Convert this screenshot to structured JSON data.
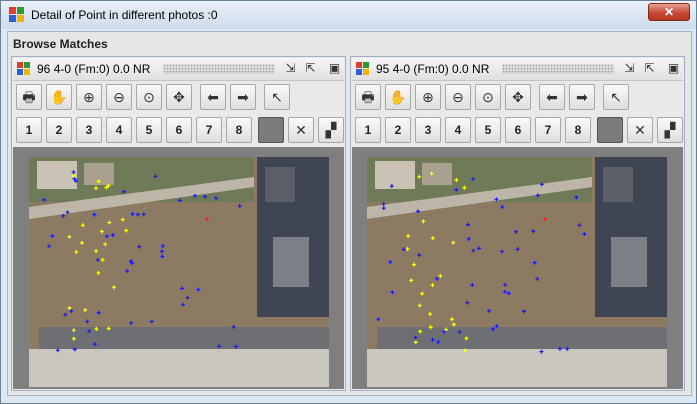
{
  "window": {
    "title": "Detail of Point in different photos :0",
    "close_symbol": "✕",
    "icon": "app-grid-icon"
  },
  "frame": {
    "label": "Browse Matches"
  },
  "panels": [
    {
      "photo_id": "96",
      "photo_label": "4-0 (Fm:0) 0.0  NR",
      "header_icon": "photo-grid-icon"
    },
    {
      "photo_id": "95",
      "photo_label": "4-0 (Fm:0) 0.0  NR",
      "header_icon": "photo-grid-icon"
    }
  ],
  "toolbar": {
    "tools": [
      {
        "name": "print-icon",
        "glyph": "🖶"
      },
      {
        "name": "pan-hand-icon",
        "glyph": "✋"
      },
      {
        "name": "zoom-in-icon",
        "glyph": "⊕"
      },
      {
        "name": "zoom-out-icon",
        "glyph": "⊖"
      },
      {
        "name": "zoom-fit-icon",
        "glyph": "⊙"
      },
      {
        "name": "move-icon",
        "glyph": "✥"
      },
      {
        "name": "prev-arrow-icon",
        "glyph": "⬅"
      },
      {
        "name": "next-arrow-icon",
        "glyph": "➡"
      },
      {
        "name": "pointer-icon",
        "glyph": "↖"
      }
    ],
    "numbers": [
      "1",
      "2",
      "3",
      "4",
      "5",
      "6",
      "7",
      "8"
    ],
    "extra": [
      {
        "name": "color-swatch-icon",
        "glyph": ""
      },
      {
        "name": "clear-x-icon",
        "glyph": "✕"
      },
      {
        "name": "image-settings-icon",
        "glyph": "▞"
      }
    ]
  },
  "header_buttons": [
    {
      "name": "minimize-arrow-icon",
      "glyph": "⇲"
    },
    {
      "name": "maximize-arrow-icon",
      "glyph": "⇱"
    },
    {
      "name": "image-view-icon",
      "glyph": "▣"
    }
  ],
  "colors": {
    "match_point_blue": "#1a1aff",
    "match_point_yellow": "#ffff00",
    "selected_point_red": "#ff2020"
  }
}
